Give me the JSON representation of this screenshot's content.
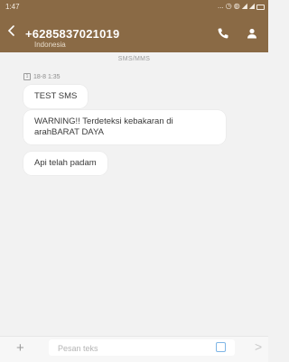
{
  "status_bar": {
    "time": "1:47",
    "dots": "..."
  },
  "header": {
    "phone_number": "+6285837021019",
    "location": "Indonesia"
  },
  "conversation": {
    "type_label": "SMS/MMS",
    "date": "18-8 1:35",
    "sim_label": "1",
    "messages": [
      {
        "text": "TEST SMS"
      },
      {
        "text": "WARNING!! Terdeteksi kebakaran di arahBARAT DAYA"
      },
      {
        "text": "Api telah padam"
      }
    ]
  },
  "composer": {
    "placeholder": "Pesan teks",
    "plus": "+",
    "send": ">"
  },
  "colors": {
    "header_bg": "#8a6a45",
    "accent": "#7fb6e6"
  }
}
